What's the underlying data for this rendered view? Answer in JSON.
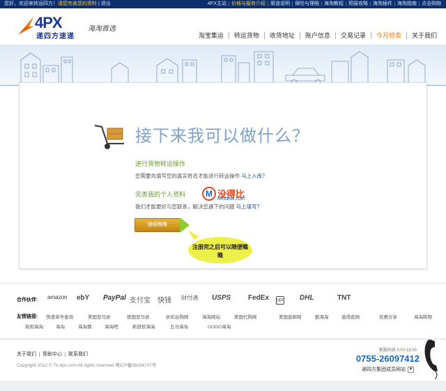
{
  "topbar": {
    "welcome": "您好，欢迎来转运四方！",
    "register_prompt": "请您完善您的资料",
    "logout": "退出",
    "links": [
      "4PX主站",
      "价格与服务介绍",
      "渠道说明",
      "保险与理赔",
      "海淘教程",
      "预报攻略",
      "海淘插件",
      "海淘指南",
      "点击购物"
    ]
  },
  "header": {
    "logo_main": "4PX",
    "logo_cn": "递四方速递",
    "slogan": "海淘首选",
    "nav": [
      "淘宝集运",
      "转运货物",
      "收货地址",
      "账户信息",
      "交易记录",
      "今月特卖",
      "关于我们"
    ],
    "active_nav": "今月特卖"
  },
  "main": {
    "headline": "接下来我可以做什么？",
    "sec1_title": "进行货物转运操作",
    "sec1_desc": "您需要先填写您的真实姓名才能进行转运操作",
    "sec1_link": "马上入库？",
    "sec2_title": "完善我的个人资料",
    "sec2_desc": "我们才能更好与您联系，解决您遇下的问题",
    "sec2_link": "马上填写？",
    "cta": "随便瞧瞧",
    "bubble": "注册完之后可以随便瞧瞧",
    "watermark_name": "没得比",
    "watermark_url": "Meidebi.com"
  },
  "partners": {
    "label": "合作伙伴:",
    "logos": [
      "amazon",
      "ebY",
      "PayPal",
      "支付宝",
      "快钱",
      "财付通",
      "USPS",
      "FedEx",
      "ups",
      "DHL",
      "TNT"
    ],
    "links_label": "友情链接:",
    "links": [
      "快递单号查询",
      "美国亚马逊",
      "德国亚马逊",
      "折扣台购网",
      "海淘网站",
      "美国代购网",
      "美国直邮网",
      "酷海淘",
      "值得逛网",
      "优惠分享",
      "海淘购物",
      "狗狗海淘",
      "海淘",
      "海淘佣",
      "海淘吧",
      "新旅软海淘",
      "五马海淘",
      "GOGO海淘"
    ]
  },
  "footer": {
    "links": [
      "关于我们",
      "帮助中心",
      "联系我们"
    ],
    "copyright": "Copyright 2012 © Tk.4px.com All rights reserved 粤ICP备05034737号",
    "hotline_label": "客服热线 9:00-18:00",
    "hotline": "0755-26097412",
    "branch": "递四方集团成员网站"
  }
}
